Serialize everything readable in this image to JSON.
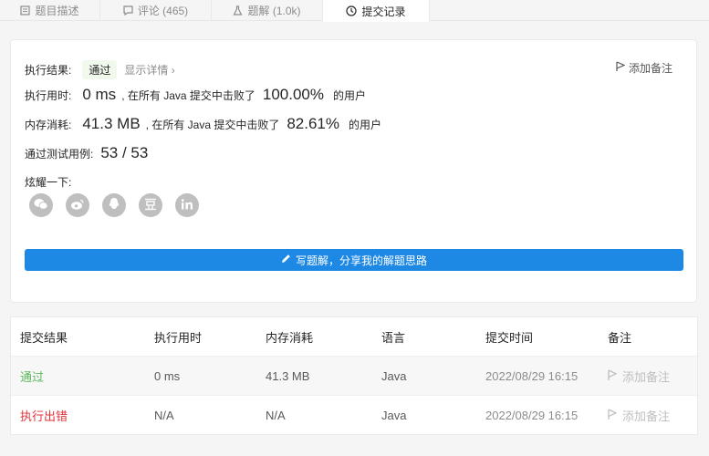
{
  "tabs": [
    {
      "label": "题目描述"
    },
    {
      "label": "评论 (465)"
    },
    {
      "label": "题解 (1.0k)"
    },
    {
      "label": "提交记录"
    }
  ],
  "result": {
    "exec_label": "执行结果:",
    "status": "通过",
    "details": "显示详情 ›",
    "add_note": "添加备注",
    "time_label": "执行用时:",
    "time_value": "0 ms",
    "time_mid": ", 在所有 Java 提交中击败了",
    "time_pct": "100.00%",
    "time_suffix": "的用户",
    "mem_label": "内存消耗:",
    "mem_value": "41.3 MB",
    "mem_mid": ", 在所有 Java 提交中击败了",
    "mem_pct": "82.61%",
    "mem_suffix": "的用户",
    "cases_label": "通过测试用例:",
    "cases_value": "53 / 53",
    "share_label": "炫耀一下:",
    "write_button": "写题解，分享我的解题思路"
  },
  "table": {
    "headers": [
      "提交结果",
      "执行用时",
      "内存消耗",
      "语言",
      "提交时间",
      "备注"
    ],
    "rows": [
      {
        "status": "通过",
        "time": "0 ms",
        "memory": "41.3 MB",
        "lang": "Java",
        "submitted": "2022/08/29 16:15",
        "note": "添加备注"
      },
      {
        "status": "执行出错",
        "time": "N/A",
        "memory": "N/A",
        "lang": "Java",
        "submitted": "2022/08/29 16:15",
        "note": "添加备注"
      }
    ]
  },
  "share_icons": [
    "wechat-icon",
    "weibo-icon",
    "qq-icon",
    "douban-icon",
    "linkedin-icon"
  ]
}
